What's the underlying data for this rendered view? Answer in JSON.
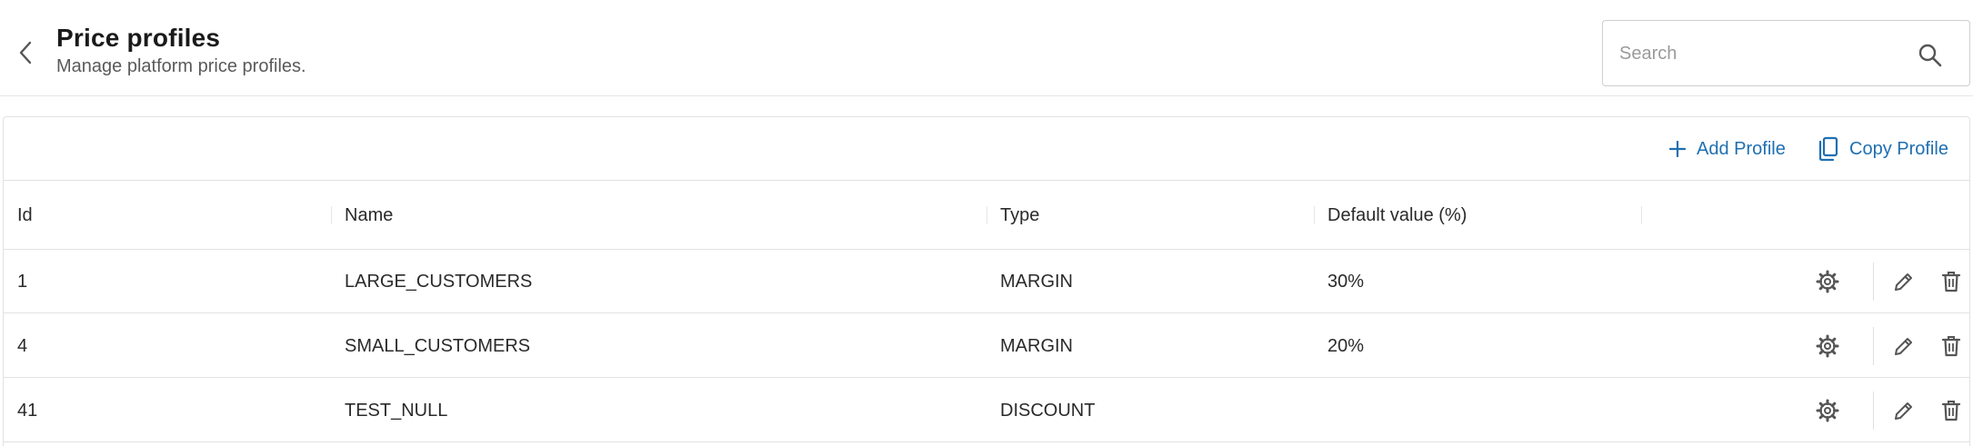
{
  "header": {
    "title": "Price profiles",
    "subtitle": "Manage platform price profiles.",
    "back_icon": "chevron-left-icon"
  },
  "search": {
    "placeholder": "Search",
    "value": "",
    "icon": "search-icon"
  },
  "toolbar": {
    "add_label": "Add Profile",
    "add_icon": "plus-icon",
    "copy_label": "Copy Profile",
    "copy_icon": "copy-icon"
  },
  "table": {
    "columns": [
      "Id",
      "Name",
      "Type",
      "Default value (%)"
    ],
    "rows": [
      {
        "id": "1",
        "name": "LARGE_CUSTOMERS",
        "type": "MARGIN",
        "default_value": "30%"
      },
      {
        "id": "4",
        "name": "SMALL_CUSTOMERS",
        "type": "MARGIN",
        "default_value": "20%"
      },
      {
        "id": "41",
        "name": "TEST_NULL",
        "type": "DISCOUNT",
        "default_value": ""
      }
    ],
    "row_action_icons": [
      "gear-icon",
      "pencil-icon",
      "trash-icon"
    ]
  },
  "colors": {
    "accent": "#1f6fb2",
    "border": "#e2e2e2",
    "icon": "#555555"
  }
}
